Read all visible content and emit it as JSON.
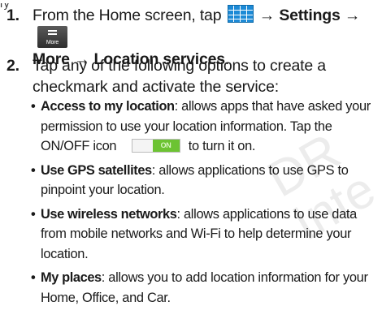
{
  "watermark": {
    "line1": "DR",
    "line2": "Inte"
  },
  "header_fragment": "ry",
  "steps": [
    {
      "number": "1.",
      "text_a": "From the Home screen, tap",
      "arrow1": "→",
      "settings": "Settings",
      "arrow2": "→",
      "more_icon_label": "More",
      "more": "More",
      "arrow3": "→",
      "location_services": "Location services",
      "end": ".",
      "icons": [
        "apps-grid-icon",
        "more-icon"
      ]
    },
    {
      "number": "2.",
      "text": "Tap any of the following options to create a checkmark and activate the service:"
    }
  ],
  "options": [
    {
      "title": "Access to my location",
      "desc_a": ": allows apps that have asked your permission to use your location information. Tap the ON/OFF icon",
      "toggle_label": "ON",
      "desc_b": "to turn it on."
    },
    {
      "title": "Use GPS satellites",
      "desc": ": allows applications to use GPS to pinpoint your location."
    },
    {
      "title": "Use wireless networks",
      "desc": ": allows applications to use data from mobile networks and Wi-Fi to help determine your location."
    },
    {
      "title": "My places",
      "desc": ": allows you to add location information for your Home, Office, and Car."
    }
  ],
  "bullet": "•",
  "colors": {
    "accent_blue": "#1d8ad6",
    "toggle_green": "#6cc332",
    "text": "#1a1a1a"
  }
}
